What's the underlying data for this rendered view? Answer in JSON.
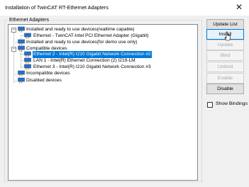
{
  "window": {
    "title": "Installation of TwinCAT RT-Ethernet Adapters",
    "close_glyph": "✕"
  },
  "group": {
    "label": "Ethernet Adapters"
  },
  "tree": {
    "installed_ready": "Installed and ready to use devices(realtime capable)",
    "installed_adapter": "Ethernet - TwinCAT-Intel PCI Ethernet Adapter (Gigabit)",
    "demo_only": "Installed and ready to use devices(for demo use only)",
    "compatible": "Compatible devices",
    "compatible_1": "Ethernet 2 - Intel(R) I210 Gigabit Network Connection #2",
    "compatible_2": "LAN 1 - Intel(R) Ethernet Connection (2) I219-LM",
    "compatible_3": "Ethernet 3 - Intel(R) I210 Gigabit Network Connection #3",
    "incompatible": "Incompatible devices",
    "disabled": "Disabled devices",
    "expander_collapsed": "−"
  },
  "buttons": {
    "update_list": "Update List",
    "install": "Install",
    "update": "Update",
    "bind": "Bind",
    "unbind": "Unbind",
    "enable": "Enable",
    "disable": "Disable"
  },
  "show_bindings": {
    "label": "Show Bindings",
    "checked": false
  },
  "colors": {
    "selection": "#0078d7",
    "adapter_icon": "#2a6fc9"
  }
}
